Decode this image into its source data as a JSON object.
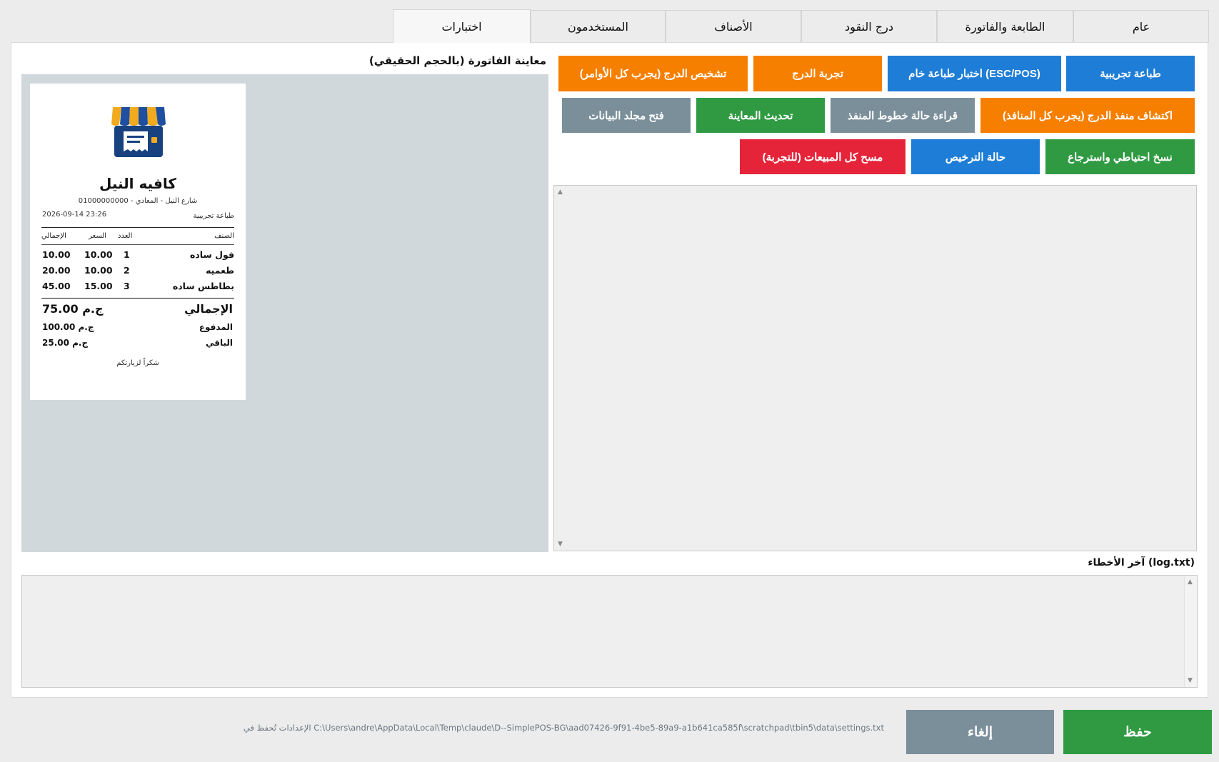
{
  "tabs": [
    {
      "label": "عام"
    },
    {
      "label": "الطابعة والفاتورة"
    },
    {
      "label": "درج النقود"
    },
    {
      "label": "الأصناف"
    },
    {
      "label": "المستخدمون"
    },
    {
      "label": "اختبارات"
    }
  ],
  "active_tab": "اختبارات",
  "buttons": {
    "test_print": "طباعة تجريبية",
    "raw_print_test": "اختبار طباعة خام (ESC/POS)",
    "drawer_test": "تجربة الدرج",
    "drawer_diagnose": "تشخيص الدرج (يجرب كل الأوامر)",
    "detect_drawer_port": "اكتشاف منفذ الدرج (يجرب كل المنافذ)",
    "read_port_lines": "قراءة حالة خطوط المنفذ",
    "refresh_preview": "تحديث المعاينة",
    "open_data_folder": "فتح مجلد البيانات",
    "backup_restore": "نسخ احتياطي واسترجاع",
    "license_status": "حالة الترخيص",
    "clear_sales": "مسح كل المبيعات (للتجربة)"
  },
  "button_colors": {
    "blue": "#1e7dd6",
    "orange": "#f77f00",
    "gray": "#7b8f9b",
    "green": "#2f9a42",
    "red": "#e5243a"
  },
  "preview": {
    "title": "معاينة الفاتورة (بالحجم الحقيقي)",
    "background": "#d1d8db"
  },
  "receipt": {
    "logo_icon": "shop-register-icon",
    "shop_name": "كافيه النيل",
    "address_line": "شارع النيل - المعادي - 01000000000",
    "print_type": "طباعة تجريبية",
    "datetime": "2026-09-14 23:26",
    "columns": {
      "item": "الصنف",
      "qty": "العدد",
      "price": "السعر",
      "total": "الإجمالي"
    },
    "items": [
      {
        "name": "فول ساده",
        "qty": "1",
        "price": "10.00",
        "total": "10.00"
      },
      {
        "name": "طعميه",
        "qty": "2",
        "price": "10.00",
        "total": "20.00"
      },
      {
        "name": "بطاطس ساده",
        "qty": "3",
        "price": "15.00",
        "total": "45.00"
      }
    ],
    "grand_total_label": "الإجمالي",
    "grand_total_value": "75.00 ج.م",
    "paid_label": "المدفوع",
    "paid_value": "100.00 ج.م",
    "remaining_label": "الباقي",
    "remaining_value": "25.00 ج.م",
    "thanks": "شكراً لزيارتكم"
  },
  "output_area": {
    "text": ""
  },
  "errors": {
    "label": "آخر الأخطاء (log.txt)",
    "text": ""
  },
  "footer": {
    "settings_path": "الإعدادات تُحفظ في C:\\Users\\andre\\AppData\\Local\\Temp\\claude\\D--SimplePOS-BG\\aad07426-9f91-4be5-89a9-a1b641ca585f\\scratchpad\\tbin5\\data\\settings.txt",
    "cancel_label": "إلغاء",
    "save_label": "حفظ"
  }
}
